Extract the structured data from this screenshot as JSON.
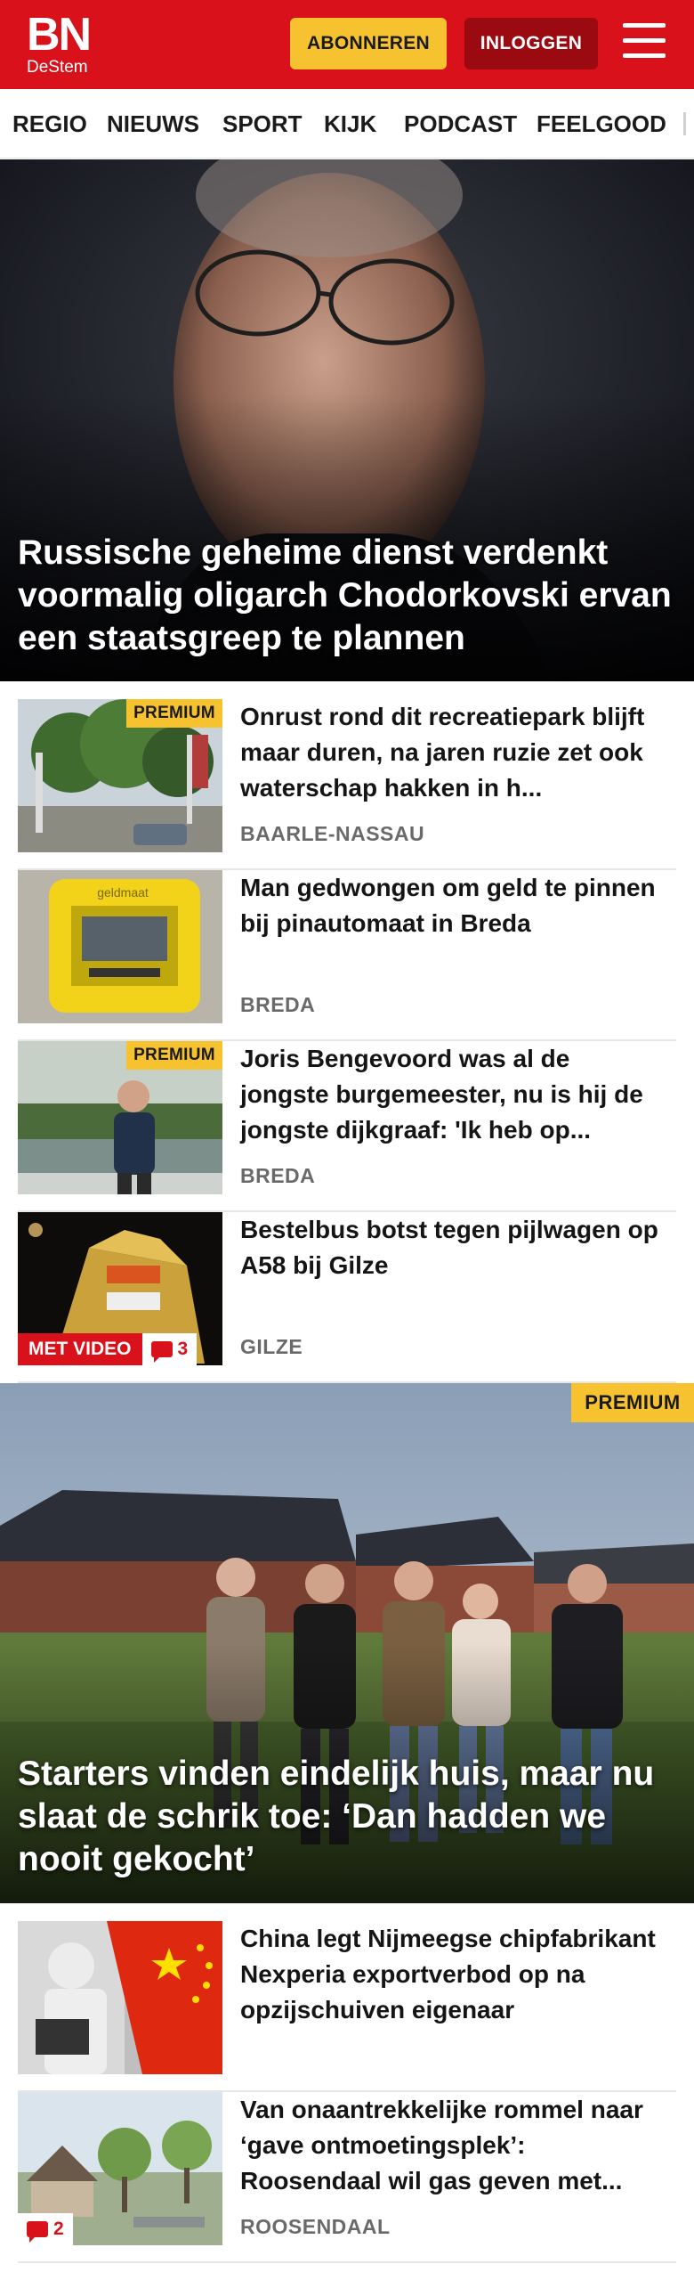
{
  "header": {
    "logo_top": "BN",
    "logo_bottom": "DeStem",
    "subscribe_label": "ABONNEREN",
    "login_label": "INLOGGEN"
  },
  "nav": {
    "items": [
      "REGIO",
      "NIEUWS",
      "SPORT",
      "KIJK",
      "PODCAST",
      "FEELGOOD"
    ]
  },
  "hero1": {
    "title": "Russische geheime dienst verdenkt voormalig oligarch Chodorkovski ervan een staatsgreep te plannen"
  },
  "articles": [
    {
      "premium": "PREMIUM",
      "title": "Onrust rond dit recreatiepark blijft maar duren, na jaren ruzie zet ook waterschap hakken in h...",
      "tag": "BAARLE-NASSAU"
    },
    {
      "title": "Man gedwongen om geld te pinnen bij pinautomaat in Breda",
      "tag": "BREDA",
      "atm_label": "geldmaat"
    },
    {
      "premium": "PREMIUM",
      "title": "Joris Bengevoord was al de jongste burgemeester, nu is hij de jongste dijkgraaf: 'Ik heb op...",
      "tag": "BREDA"
    },
    {
      "title": "Bestelbus botst tegen pijlwagen op A58 bij Gilze",
      "tag": "GILZE",
      "video_label": "MET VIDEO",
      "comments": "3"
    }
  ],
  "hero2": {
    "premium": "PREMIUM",
    "title": "Starters vinden eindelijk huis, maar nu slaat de schrik toe: ‘Dan hadden we nooit gekocht’"
  },
  "articles2": [
    {
      "title": "China legt Nijmeegse chipfabri­kant Nexperia exportverbod op na opzijschuiven eigenaar"
    },
    {
      "title": "Van onaantrekkelijke rommel naar ‘gave ontmoetingsplek’: Roosendaal wil gas geven met...",
      "tag": "ROOSENDAAL",
      "comments": "2"
    }
  ]
}
